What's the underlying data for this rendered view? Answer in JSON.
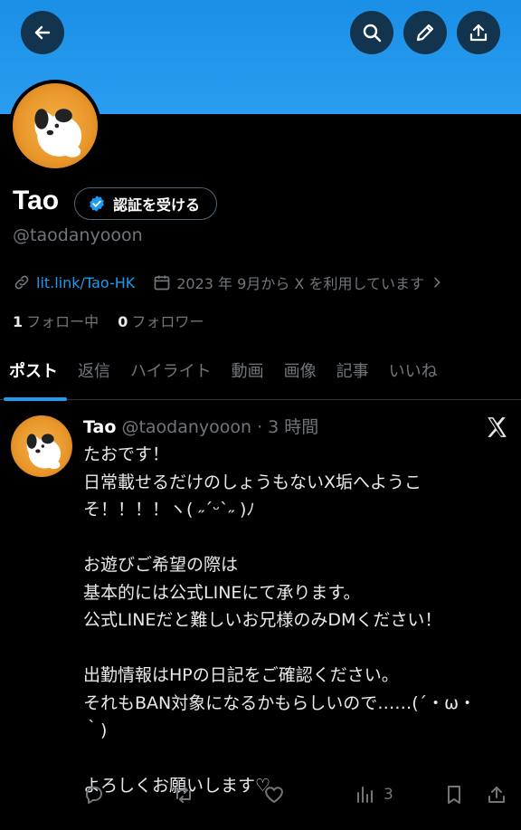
{
  "header": {
    "back_icon": "arrow-left-icon",
    "search_icon": "search-icon",
    "edit_icon": "pencil-icon",
    "share_icon": "upload-icon",
    "banner_color": "#1d9bf0"
  },
  "profile": {
    "name": "Tao",
    "verify_label": "認証を受ける",
    "handle": "@taodanyooon",
    "link": "lit.link/Tao-HK",
    "joined": "2023 年 9月から X を利用しています",
    "following_count": "1",
    "following_label": "フォロー中",
    "followers_count": "0",
    "followers_label": "フォロワー"
  },
  "tabs": [
    "ポスト",
    "返信",
    "ハイライト",
    "動画",
    "画像",
    "記事",
    "いいね"
  ],
  "post": {
    "name": "Tao",
    "handle_time": "@taodanyooon · 3 時間",
    "body": "たおです！\n日常載せるだけのしょうもないX垢へようこ\nそ！！！！ヽ( ˶ˊᵕˋ˶ )ﾉ\n\nお遊びご希望の際は\n基本的には公式LINEにて承ります。\n公式LINEだと難しいお兄様のみDMください！\n\n出勤情報はHPの日記をご確認ください。\nそれもBAN対象になるかもらしいので……(´・ω・\n｀)\n\nよろしくお願いします♡",
    "views": "3"
  },
  "colors": {
    "accent": "#1d9bf0",
    "muted": "#71767b",
    "text": "#e7e9ea",
    "background": "#000000"
  }
}
